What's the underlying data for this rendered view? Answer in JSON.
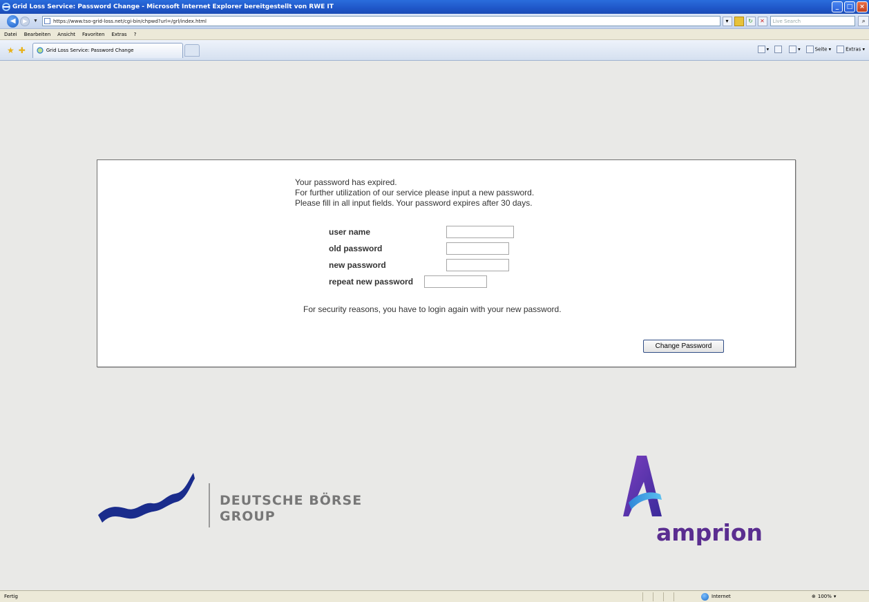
{
  "window": {
    "title": "Grid Loss Service: Password Change - Microsoft Internet Explorer bereitgestellt von RWE IT",
    "controls": [
      "_",
      "□",
      "×"
    ]
  },
  "address_bar": {
    "url": "https://www.tso-grid-loss.net/cgi-bin/chpwd?url=/grl/index.html",
    "search_placeholder": "Live Search"
  },
  "menu": [
    "Datei",
    "Bearbeiten",
    "Ansicht",
    "Favoriten",
    "Extras",
    "?"
  ],
  "tabs": [
    {
      "label": "Grid Loss Service: Password Change"
    }
  ],
  "command_bar": {
    "page_label": "Seite",
    "tools_label": "Extras"
  },
  "page": {
    "message_lines": [
      "Your password has expired.",
      "For further utilization of our service please input a new password.",
      "Please fill in all input fields. Your password expires after 30 days."
    ],
    "fields": {
      "user_name": {
        "label": "user name",
        "value": ""
      },
      "old_password": {
        "label": "old password",
        "value": ""
      },
      "new_password": {
        "label": "new password",
        "value": ""
      },
      "repeat_new_password": {
        "label": "repeat new password",
        "value": ""
      }
    },
    "security_note": "For security reasons, you have to login again with your new password.",
    "submit_label": "Change Password"
  },
  "logos": {
    "deutsche_boerse": {
      "line1": "DEUTSCHE BÖRSE",
      "line2": "GROUP",
      "color": "#1a2c8c"
    },
    "amprion": {
      "text": "amprion",
      "color": "#5a2d90"
    }
  },
  "status_bar": {
    "status": "Fertig",
    "zone": "Internet",
    "zoom": "100%"
  }
}
